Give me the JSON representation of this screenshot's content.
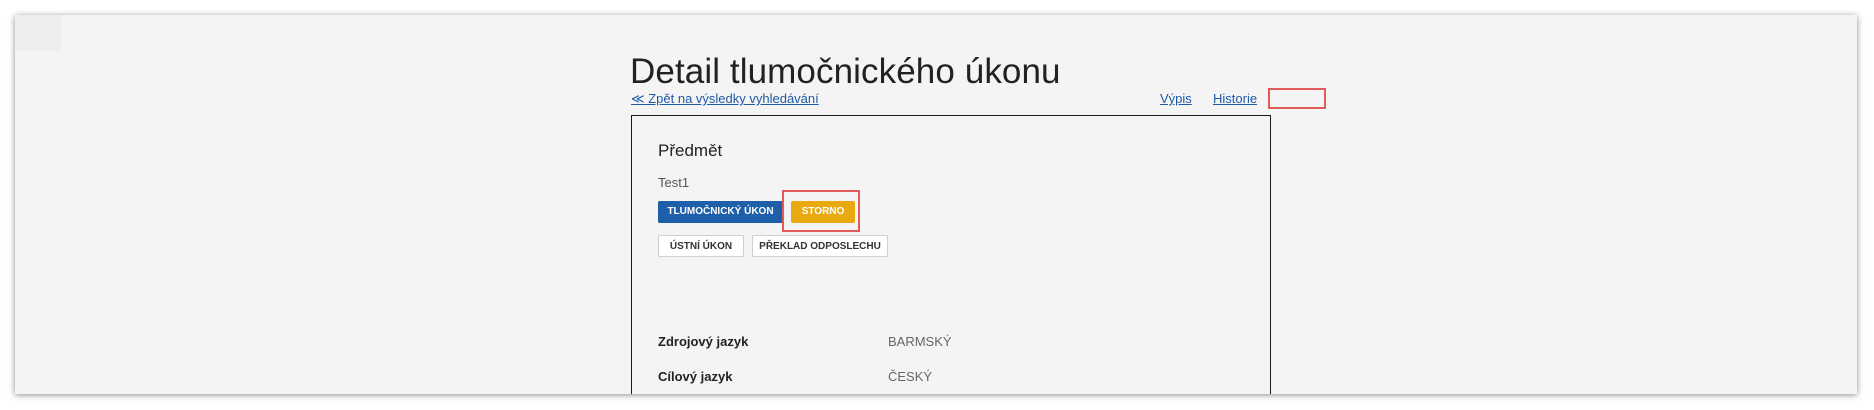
{
  "page": {
    "title": "Detail tlumočnického úkonu"
  },
  "nav": {
    "back_label": "≪ Zpět na výsledky vyhledávání",
    "vypis_label": "Výpis",
    "historie_label": "Historie"
  },
  "detail": {
    "section_heading": "Předmět",
    "subject_value": "Test1",
    "buttons": {
      "primary_label": "TLUMOČNICKÝ ÚKON",
      "storno_label": "STORNO",
      "ustni_label": "ÚSTNÍ ÚKON",
      "preklad_label": "PŘEKLAD ODPOSLECHU"
    },
    "fields": [
      {
        "label": "Zdrojový jazyk",
        "value": "BARMSKÝ"
      },
      {
        "label": "Cílový jazyk",
        "value": "ČESKÝ"
      }
    ]
  },
  "colors": {
    "primary_blue": "#1f5ea8",
    "storno_yellow": "#e8aa10",
    "link_blue": "#1f5aa6",
    "highlight_red": "#e05a5a",
    "page_bg": "#f4f4f4"
  }
}
